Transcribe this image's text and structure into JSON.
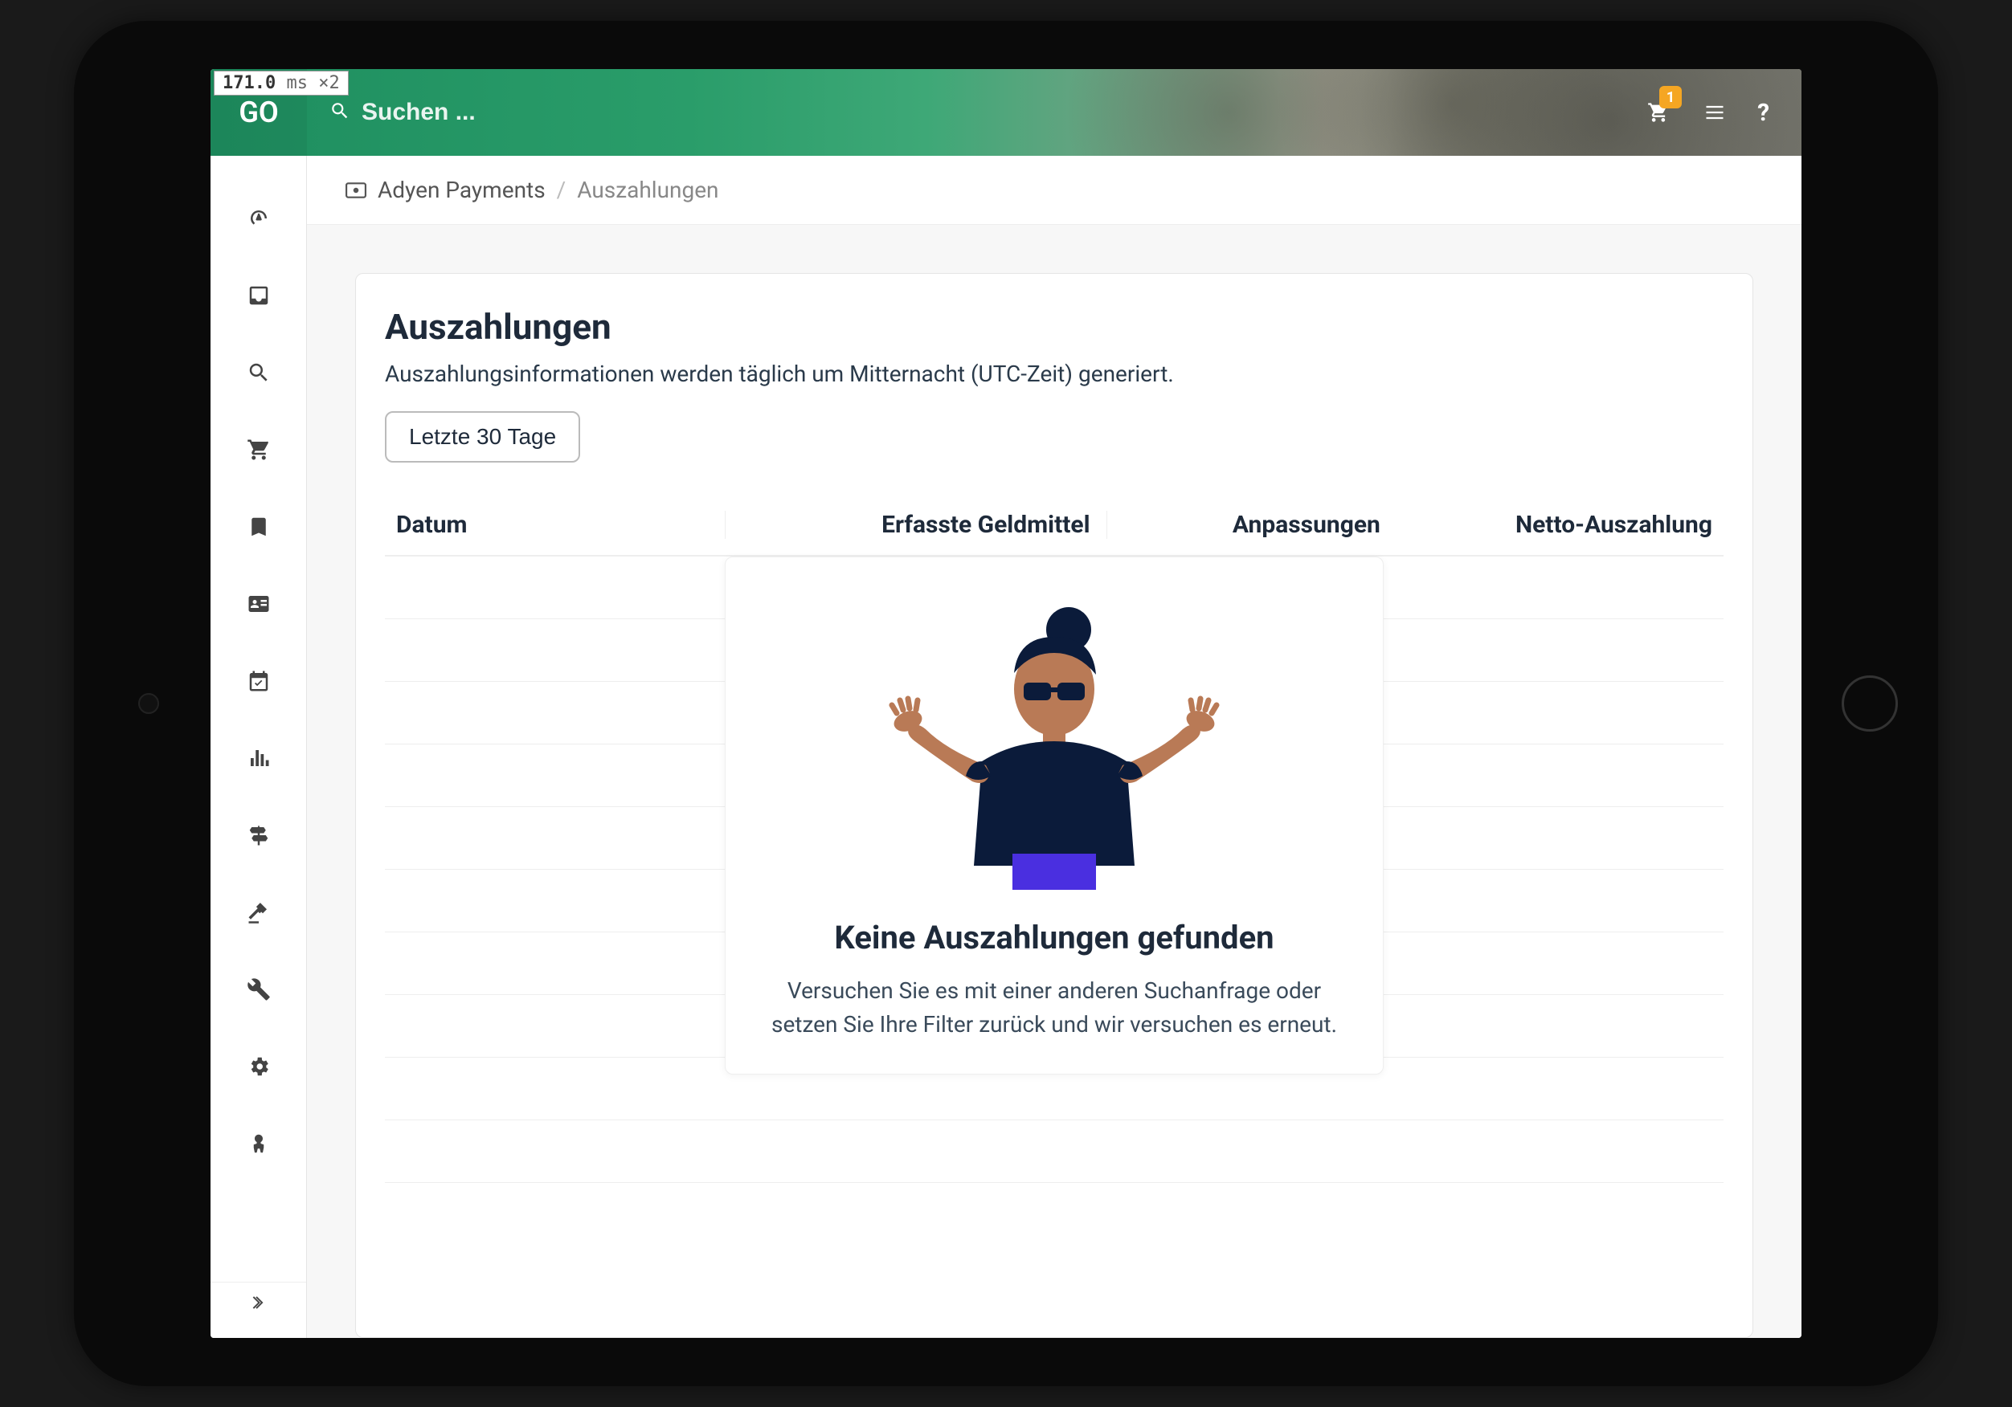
{
  "perf": {
    "ms": "171.0",
    "unit": "ms",
    "mult": "×2"
  },
  "logo": "GO",
  "search": {
    "placeholder": "Suchen ..."
  },
  "topbar": {
    "cart_badge": "1"
  },
  "breadcrumb": {
    "root": "Adyen Payments",
    "current": "Auszahlungen"
  },
  "page": {
    "title": "Auszahlungen",
    "subtitle": "Auszahlungsinformationen werden täglich um Mitternacht (UTC-Zeit) generiert.",
    "filter_label": "Letzte 30 Tage"
  },
  "table": {
    "headers": {
      "date": "Datum",
      "captured": "Erfasste Geldmittel",
      "adjustments": "Anpassungen",
      "net": "Netto-Auszahlung"
    }
  },
  "empty": {
    "title": "Keine Auszahlungen gefunden",
    "text": "Versuchen Sie es mit einer anderen Suchanfrage oder setzen Sie Ihre Filter zurück und wir versuchen es erneut."
  },
  "sidebar": {
    "items": [
      "dashboard",
      "inbox",
      "search",
      "cart",
      "bookmark",
      "id-card",
      "calendar",
      "chart-bars",
      "signpost",
      "gavel",
      "wrench",
      "gears",
      "person"
    ]
  }
}
